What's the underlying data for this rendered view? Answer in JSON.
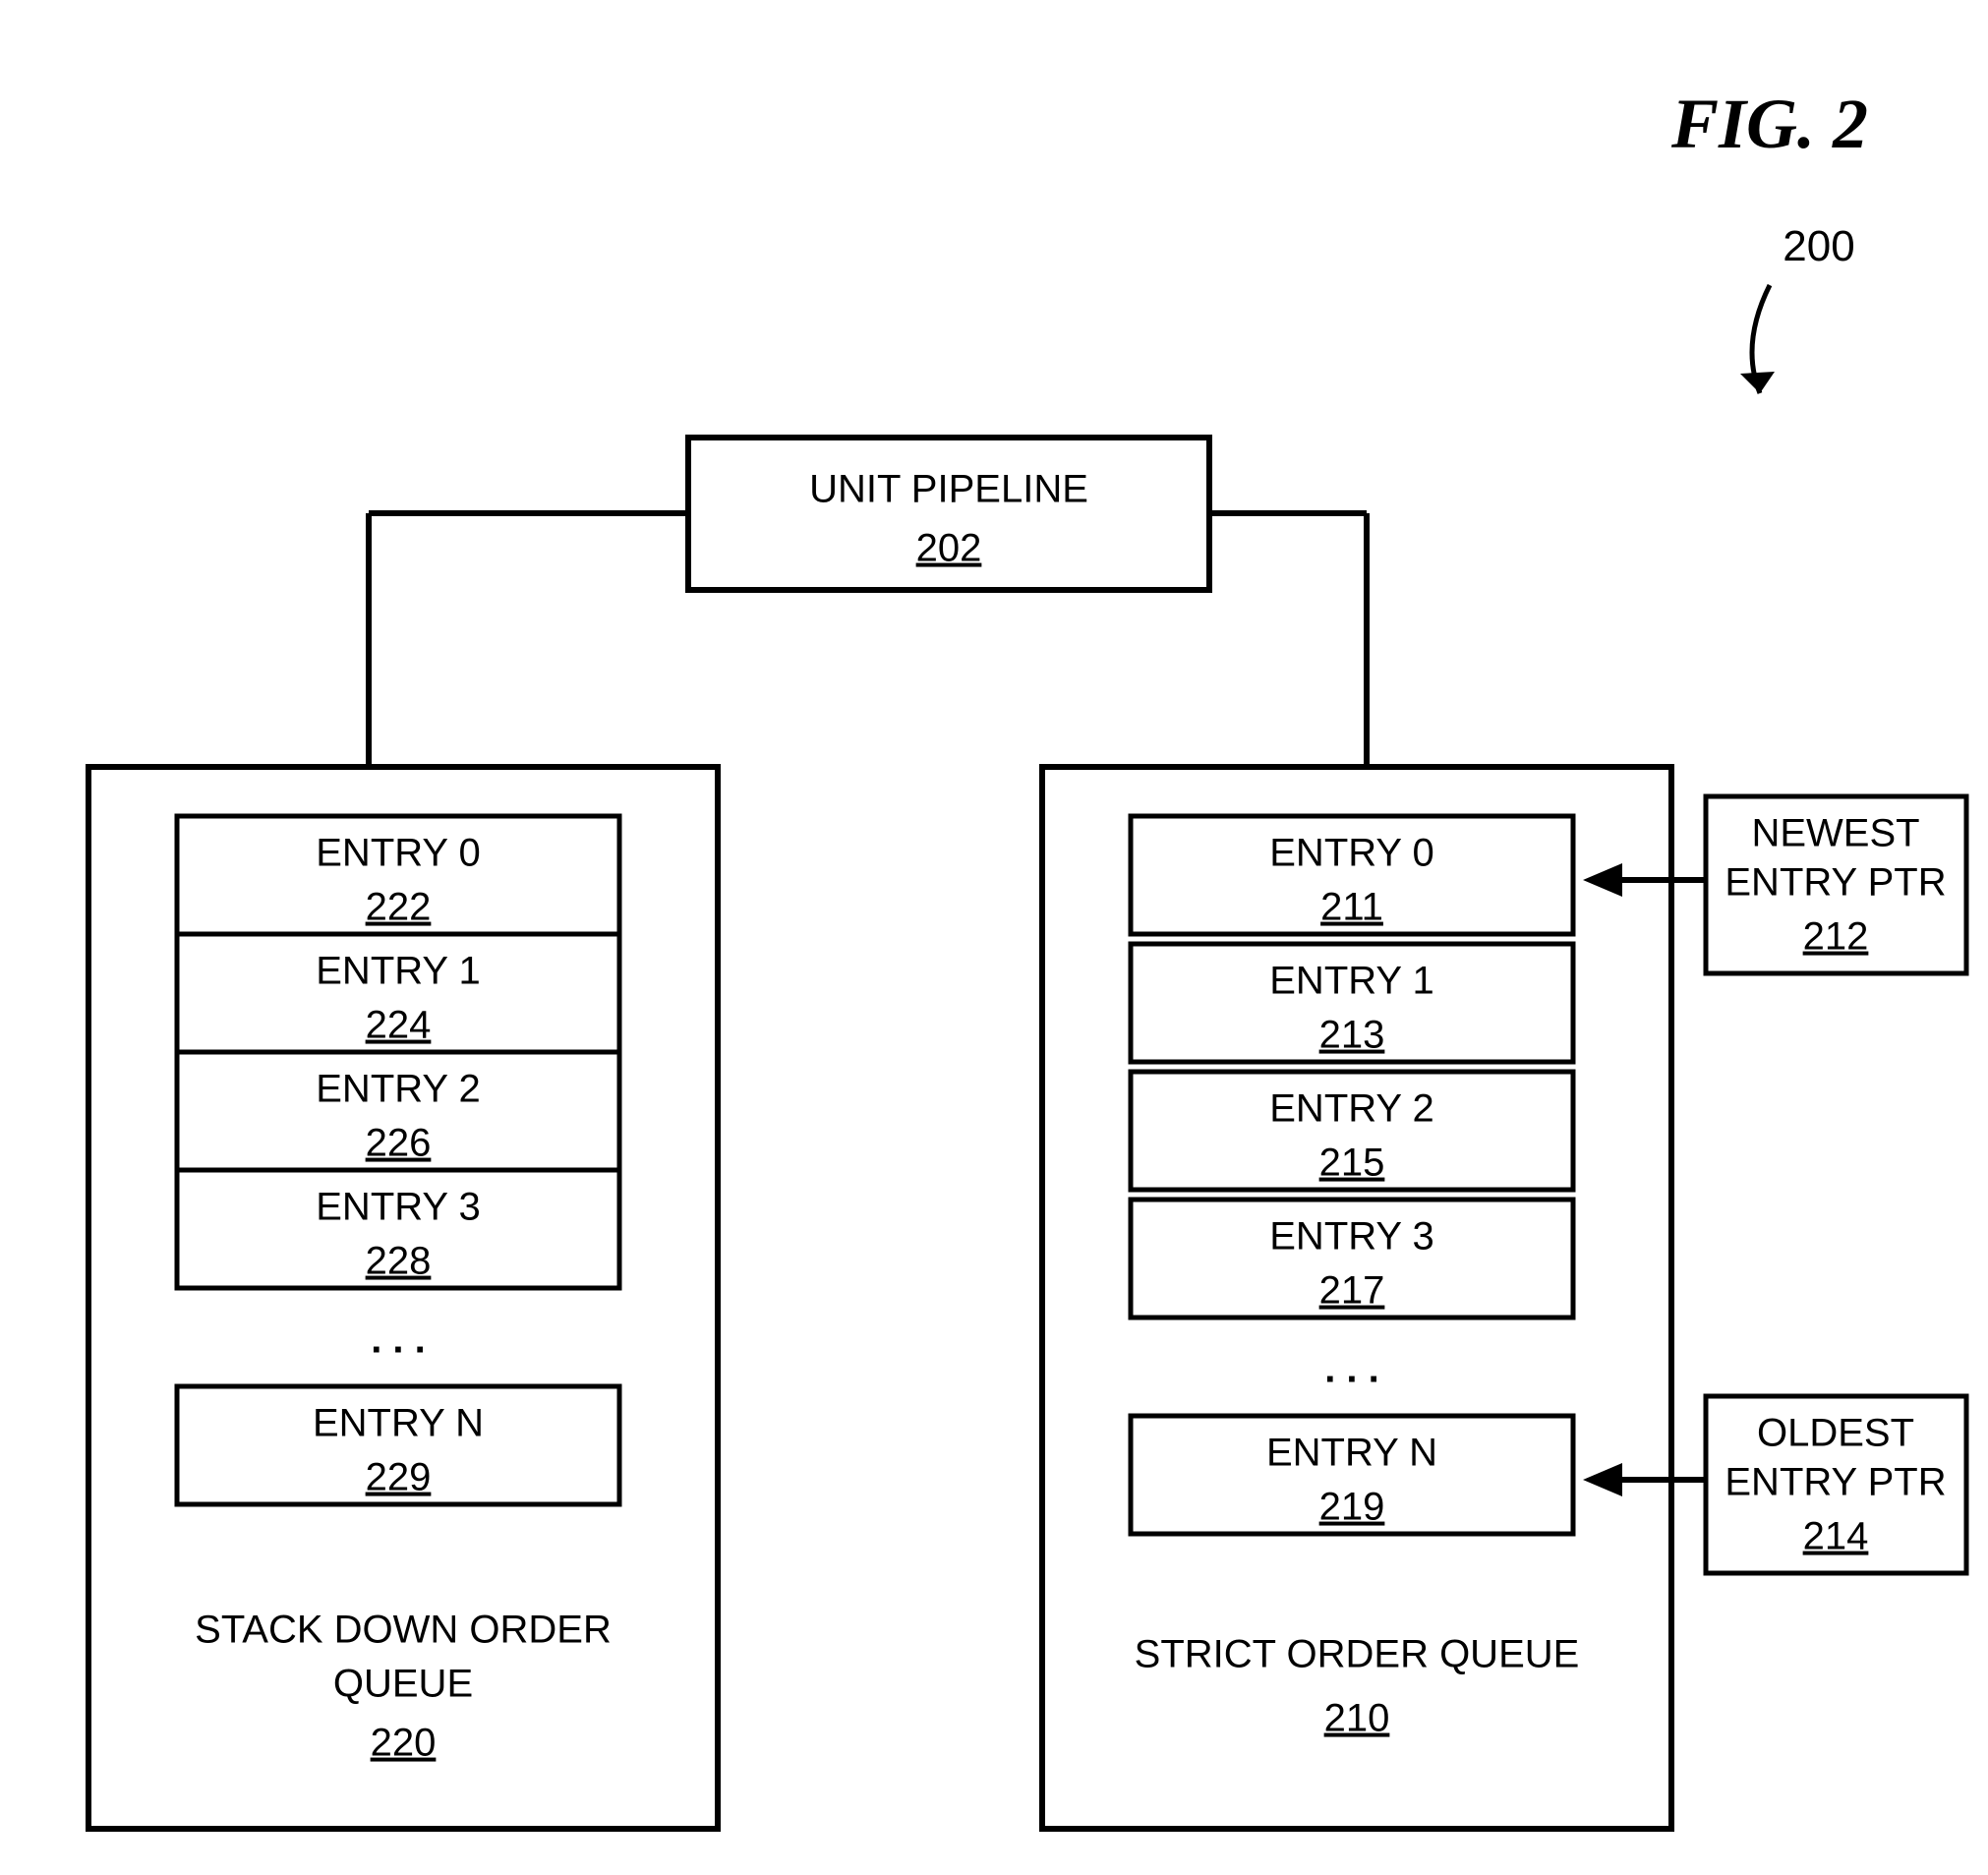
{
  "figure": {
    "title": "FIG. 2",
    "ref": "200"
  },
  "unit_pipeline": {
    "label": "UNIT PIPELINE",
    "ref": "202"
  },
  "left_queue": {
    "label1": "STACK DOWN ORDER",
    "label2": "QUEUE",
    "ref": "220",
    "entries": [
      {
        "label": "ENTRY 0",
        "ref": "222"
      },
      {
        "label": "ENTRY 1",
        "ref": "224"
      },
      {
        "label": "ENTRY 2",
        "ref": "226"
      },
      {
        "label": "ENTRY 3",
        "ref": "228"
      },
      {
        "label": "ENTRY N",
        "ref": "229"
      }
    ]
  },
  "right_queue": {
    "label": "STRICT ORDER QUEUE",
    "ref": "210",
    "entries": [
      {
        "label": "ENTRY 0",
        "ref": "211"
      },
      {
        "label": "ENTRY 1",
        "ref": "213"
      },
      {
        "label": "ENTRY 2",
        "ref": "215"
      },
      {
        "label": "ENTRY 3",
        "ref": "217"
      },
      {
        "label": "ENTRY N",
        "ref": "219"
      }
    ]
  },
  "newest_ptr": {
    "label1": "NEWEST",
    "label2": "ENTRY PTR",
    "ref": "212"
  },
  "oldest_ptr": {
    "label1": "OLDEST",
    "label2": "ENTRY PTR",
    "ref": "214"
  },
  "ellipsis": ". . ."
}
